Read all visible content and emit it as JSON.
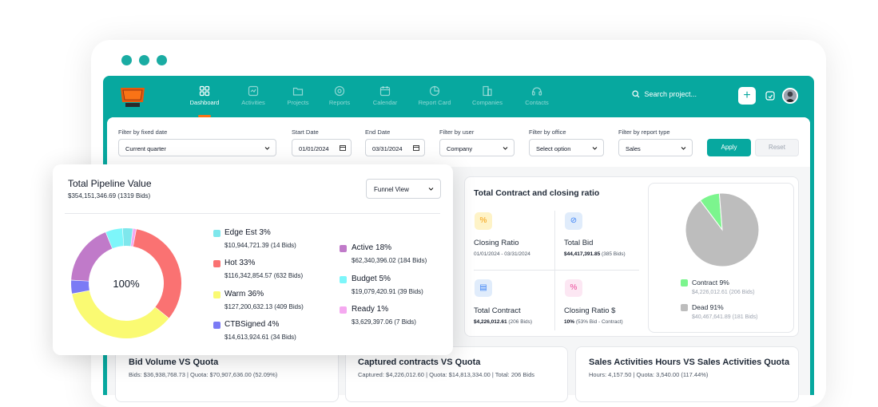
{
  "nav": {
    "items": [
      {
        "label": "Dashboard",
        "icon": "grid-icon"
      },
      {
        "label": "Activities",
        "icon": "activity-icon"
      },
      {
        "label": "Projects",
        "icon": "folder-icon"
      },
      {
        "label": "Reports",
        "icon": "target-icon"
      },
      {
        "label": "Calendar",
        "icon": "calendar-icon"
      },
      {
        "label": "Report Card",
        "icon": "report-card-icon"
      },
      {
        "label": "Companies",
        "icon": "building-icon"
      },
      {
        "label": "Contacts",
        "icon": "headset-icon"
      }
    ],
    "search_placeholder": "Search project...",
    "plus": "+",
    "colors": {
      "brand": "#07a89f",
      "accent": "#f97316"
    }
  },
  "filters": {
    "fixed_date": {
      "label": "Filter by fixed date",
      "value": "Current quarter"
    },
    "start_date": {
      "label": "Start Date",
      "value": "01/01/2024"
    },
    "end_date": {
      "label": "End Date",
      "value": "03/31/2024"
    },
    "user": {
      "label": "Filter by user",
      "value": "Company"
    },
    "office": {
      "label": "Filter by office",
      "value": "Select option"
    },
    "report_type": {
      "label": "Filter by report type",
      "value": "Sales"
    },
    "apply": "Apply",
    "reset": "Reset"
  },
  "contract_card": {
    "title": "Total Contract and closing ratio",
    "metrics": [
      {
        "icon_glyph": "%",
        "title": "Closing Ratio",
        "sub": "01/01/2024 - 03/31/2024",
        "sub_value": "",
        "color": "#f59e0b",
        "bg": "#fef3c7"
      },
      {
        "icon_glyph": "⊘",
        "title": "Total Bid",
        "sub": "",
        "sub_value": "$44,417,391.85",
        "sub_rest": " (385 Bids)",
        "color": "#3b82f6",
        "bg": "#e0ecfb"
      },
      {
        "icon_glyph": "▤",
        "title": "Total Contract",
        "sub": "",
        "sub_value": "$4,226,012.61",
        "sub_rest": " (206 Bids)",
        "color": "#3b82f6",
        "bg": "#e0ecfb"
      },
      {
        "icon_glyph": "%",
        "title": "Closing Ratio $",
        "sub": "",
        "sub_value": "10%",
        "sub_rest": " (53% Bid - Contract)",
        "color": "#ec4899",
        "bg": "#fce7f3"
      }
    ],
    "pie": {
      "slices": [
        {
          "name": "Contract 9%",
          "value": 9,
          "color": "#7cf58e",
          "sub": "$4,226,012.61 (206 Bids)"
        },
        {
          "name": "Dead 91%",
          "value": 91,
          "color": "#bdbdbd",
          "sub": "$40,467,641.89 (181 Bids)"
        }
      ]
    }
  },
  "pipeline": {
    "title": "Total Pipeline Value",
    "subtitle": "$354,151,346.69 (1319 Bids)",
    "view_select": "Funnel View",
    "center_label": "100%",
    "chart_data": {
      "type": "pie",
      "title": "Total Pipeline Value",
      "series": [
        {
          "name": "Edge Est 3%",
          "value": 3,
          "color": "#7ee7ec",
          "sub": "$10,944,721.39 (14 Bids)"
        },
        {
          "name": "Hot 33%",
          "value": 33,
          "color": "#fa7272",
          "sub": "$116,342,854.57 (632 Bids)"
        },
        {
          "name": "Warm 36%",
          "value": 36,
          "color": "#fafa72",
          "sub": "$127,200,632.13 (409 Bids)"
        },
        {
          "name": "CTBSigned 4%",
          "value": 4,
          "color": "#7b7bf5",
          "sub": "$14,613,924.61 (34 Bids)"
        },
        {
          "name": "Active 18%",
          "value": 18,
          "color": "#c07ac9",
          "sub": "$62,340,396.02 (184 Bids)"
        },
        {
          "name": "Budget 5%",
          "value": 5,
          "color": "#7df6fa",
          "sub": "$19,079,420.91 (39 Bids)"
        },
        {
          "name": "Ready 1%",
          "value": 1,
          "color": "#f5a9f0",
          "sub": "$3,629,397.06 (7 Bids)"
        }
      ]
    }
  },
  "bottom_cards": [
    {
      "title": "Bid Volume VS Quota",
      "sub": "Bids: $36,938,768.73  |  Quota: $70,907,636.00 (52.09%)"
    },
    {
      "title": "Captured contracts VS Quota",
      "sub": "Captured: $4,226,012.60  |  Quota: $14,813,334.00  |  Total: 206 Bids"
    },
    {
      "title": "Sales Activities Hours VS Sales Activities Quota",
      "sub": "Hours: 4,157.50  |  Quota: 3,540.00 (117.44%)"
    }
  ]
}
